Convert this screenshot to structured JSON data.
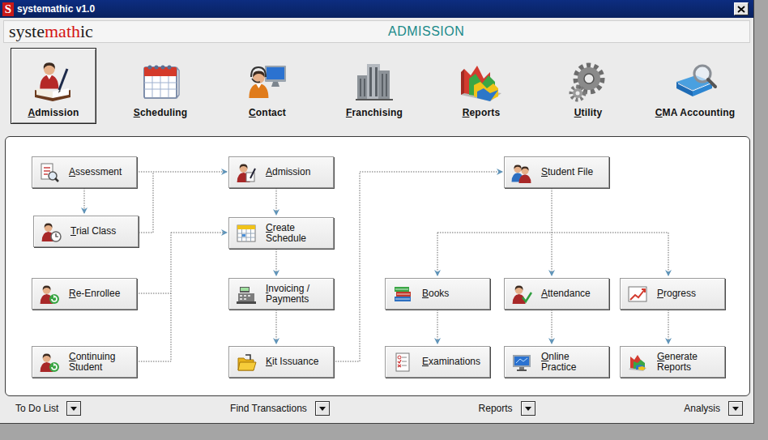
{
  "window": {
    "title": "systemathic v1.0",
    "icon": "S"
  },
  "header": {
    "logo": [
      {
        "text": "syste",
        "color": "#1c1c1c"
      },
      {
        "text": "math",
        "color": "#d41414"
      },
      {
        "text": "ic",
        "color": "#1c1c1c"
      }
    ],
    "section": "ADMISSION"
  },
  "toolbar": [
    {
      "label": "Admission",
      "selected": true
    },
    {
      "label": "Scheduling",
      "selected": false
    },
    {
      "label": "Contact",
      "selected": false
    },
    {
      "label": "Franchising",
      "selected": false
    },
    {
      "label": "Reports",
      "selected": false
    },
    {
      "label": "Utility",
      "selected": false
    },
    {
      "label": "CMA Accounting",
      "selected": false
    }
  ],
  "flow": {
    "nodes": [
      {
        "lines": [
          "Assessment"
        ]
      },
      {
        "lines": [
          "Trial Class"
        ]
      },
      {
        "lines": [
          "Re-Enrollee"
        ]
      },
      {
        "lines": [
          "Continuing",
          "Student"
        ]
      },
      {
        "lines": [
          "Admission"
        ]
      },
      {
        "lines": [
          "Create",
          "Schedule"
        ]
      },
      {
        "lines": [
          "Invoicing /",
          "Payments"
        ]
      },
      {
        "lines": [
          "Kit Issuance"
        ]
      },
      {
        "lines": [
          "Student File"
        ]
      },
      {
        "lines": [
          "Books"
        ]
      },
      {
        "lines": [
          "Attendance"
        ]
      },
      {
        "lines": [
          "Progress"
        ]
      },
      {
        "lines": [
          "Examinations"
        ]
      },
      {
        "lines": [
          "Online",
          "Practice"
        ]
      },
      {
        "lines": [
          "Generate",
          "Reports"
        ]
      }
    ]
  },
  "bottom_bar": [
    {
      "label": "To Do List"
    },
    {
      "label": "Find Transactions"
    },
    {
      "label": "Reports"
    },
    {
      "label": "Analysis"
    }
  ]
}
